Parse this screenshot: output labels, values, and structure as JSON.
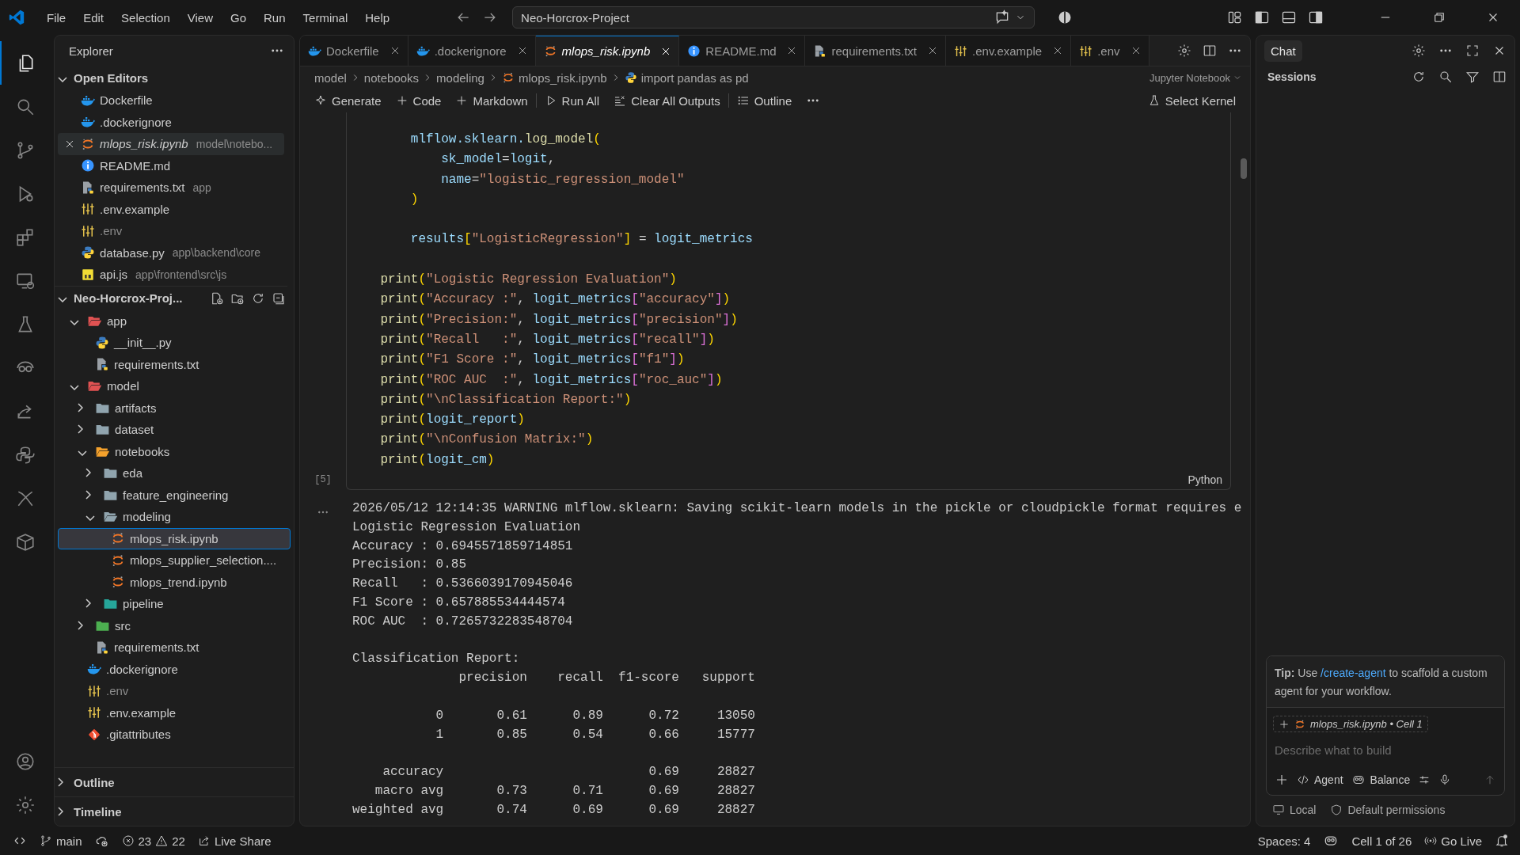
{
  "title_bar": {
    "menus": [
      "File",
      "Edit",
      "Selection",
      "View",
      "Go",
      "Run",
      "Terminal",
      "Help"
    ],
    "command_center": "Neo-Horcrox-Project"
  },
  "activity_bar": [
    {
      "selected": true
    },
    {
      "selected": false
    },
    {
      "selected": false
    },
    {
      "selected": false
    },
    {
      "selected": false
    },
    {
      "selected": false
    },
    {
      "selected": false
    },
    {
      "selected": false
    },
    {
      "selected": false
    },
    {
      "selected": false
    },
    {
      "selected": false
    },
    {
      "selected": false
    }
  ],
  "explorer": {
    "title": "Explorer",
    "open_editors": {
      "title": "Open Editors",
      "expanded": true,
      "items": [
        {
          "label": "Dockerfile",
          "kind": "docker",
          "selected": false,
          "preview": false,
          "dimmed": false
        },
        {
          "label": ".dockerignore",
          "kind": "docker",
          "selected": false,
          "preview": false,
          "dimmed": false
        },
        {
          "label": "mlops_risk.ipynb",
          "description": "model\\notebo...",
          "kind": "notebook",
          "selected": true,
          "preview": true,
          "dimmed": false
        },
        {
          "label": "README.md",
          "kind": "info",
          "selected": false,
          "preview": false,
          "dimmed": false
        },
        {
          "label": "requirements.txt",
          "description": "app",
          "kind": "text",
          "selected": false,
          "preview": false,
          "dimmed": false
        },
        {
          "label": ".env.example",
          "kind": "env",
          "selected": false,
          "preview": false,
          "dimmed": false
        },
        {
          "label": ".env",
          "kind": "env",
          "selected": false,
          "preview": false,
          "dimmed": true
        },
        {
          "label": "database.py",
          "description": "app\\backend\\core",
          "kind": "python",
          "selected": false,
          "preview": false,
          "dimmed": false
        },
        {
          "label": "api.js",
          "description": "app\\frontend\\src\\js",
          "kind": "js",
          "selected": false,
          "preview": false,
          "dimmed": false
        }
      ]
    },
    "folder": {
      "title": "Neo-Horcrox-Proj...",
      "expanded": true,
      "items": [
        {
          "label": "app",
          "kind": "folder",
          "color": "#e05252",
          "expanded": true,
          "selected": false,
          "dimmed": false,
          "children": [
            {
              "label": "__init__.py",
              "kind": "python",
              "selected": false,
              "dimmed": false
            },
            {
              "label": "requirements.txt",
              "kind": "text",
              "selected": false,
              "dimmed": false
            }
          ]
        },
        {
          "label": "model",
          "kind": "folder",
          "color": "#e05252",
          "expanded": true,
          "selected": false,
          "dimmed": false,
          "children": [
            {
              "label": "artifacts",
              "kind": "folder",
              "color": "#90a4ae",
              "expanded": false,
              "selected": false,
              "dimmed": false
            },
            {
              "label": "dataset",
              "kind": "folder",
              "color": "#90a4ae",
              "expanded": false,
              "selected": false,
              "dimmed": false
            },
            {
              "label": "notebooks",
              "kind": "folder",
              "color": "#f4a12c",
              "expanded": true,
              "selected": false,
              "dimmed": false,
              "children": [
                {
                  "label": "eda",
                  "kind": "folder",
                  "color": "#90a4ae",
                  "expanded": false,
                  "selected": false,
                  "dimmed": false
                },
                {
                  "label": "feature_engineering",
                  "kind": "folder",
                  "color": "#90a4ae",
                  "expanded": false,
                  "selected": false,
                  "dimmed": false
                },
                {
                  "label": "modeling",
                  "kind": "folder",
                  "color": "#90a4ae",
                  "expanded": true,
                  "selected": false,
                  "dimmed": false,
                  "children": [
                    {
                      "label": "mlops_risk.ipynb",
                      "kind": "notebook",
                      "selected": true,
                      "dimmed": false
                    },
                    {
                      "label": "mlops_supplier_selection....",
                      "kind": "notebook",
                      "selected": false,
                      "dimmed": false
                    },
                    {
                      "label": "mlops_trend.ipynb",
                      "kind": "notebook",
                      "selected": false,
                      "dimmed": false
                    }
                  ]
                },
                {
                  "label": "pipeline",
                  "kind": "folder",
                  "color": "#26a69a",
                  "expanded": false,
                  "selected": false,
                  "dimmed": false
                }
              ]
            },
            {
              "label": "src",
              "kind": "folder",
              "color": "#4caf50",
              "expanded": false,
              "selected": false,
              "dimmed": false
            },
            {
              "label": "requirements.txt",
              "kind": "text",
              "selected": false,
              "dimmed": false
            }
          ]
        },
        {
          "label": ".dockerignore",
          "kind": "docker",
          "selected": false,
          "dimmed": false
        },
        {
          "label": ".env",
          "kind": "env",
          "selected": false,
          "dimmed": true
        },
        {
          "label": ".env.example",
          "kind": "env",
          "selected": false,
          "dimmed": false
        },
        {
          "label": ".gitattributes",
          "kind": "git",
          "selected": false,
          "dimmed": false
        }
      ]
    },
    "sections": [
      {
        "title": "Outline",
        "expanded": false
      },
      {
        "title": "Timeline",
        "expanded": false
      }
    ]
  },
  "tabs": [
    {
      "label": "Dockerfile",
      "kind": "docker",
      "selected": false,
      "preview": false
    },
    {
      "label": ".dockerignore",
      "kind": "docker",
      "selected": false,
      "preview": false
    },
    {
      "label": "mlops_risk.ipynb",
      "kind": "notebook",
      "selected": true,
      "preview": true
    },
    {
      "label": "README.md",
      "kind": "info",
      "selected": false,
      "preview": false
    },
    {
      "label": "requirements.txt",
      "kind": "text",
      "selected": false,
      "preview": false
    },
    {
      "label": ".env.example",
      "kind": "env",
      "selected": false,
      "preview": false
    },
    {
      "label": ".env",
      "kind": "env",
      "selected": false,
      "preview": false
    }
  ],
  "breadcrumbs": [
    {
      "label": "model",
      "kind": "folder"
    },
    {
      "label": "notebooks",
      "kind": "folder"
    },
    {
      "label": "modeling",
      "kind": "folder"
    },
    {
      "label": "mlops_risk.ipynb",
      "kind": "notebook"
    },
    {
      "label": "import pandas as pd",
      "kind": "python"
    }
  ],
  "notebook_kind": "Jupyter Notebook",
  "toolbar": [
    {
      "kind": "generate",
      "label": "Generate"
    },
    {
      "kind": "code",
      "label": "Code"
    },
    {
      "kind": "markdown",
      "label": "Markdown"
    },
    {
      "kind": "divider"
    },
    {
      "kind": "run",
      "label": "Run All"
    },
    {
      "kind": "clear",
      "label": "Clear All Outputs"
    },
    {
      "kind": "divider"
    },
    {
      "kind": "outline",
      "label": "Outline"
    },
    {
      "kind": "more"
    }
  ],
  "kernel": "Select Kernel",
  "cell": {
    "execution_count": "[5]",
    "language": "Python",
    "lines": [
      {
        "kind": "code",
        "segments": [
          {
            "text": "        mlflow.sklearn.",
            "kind": "var"
          },
          {
            "text": "log_model",
            "kind": "fn"
          },
          {
            "text": "(",
            "kind": "b1"
          }
        ]
      },
      {
        "kind": "code",
        "segments": [
          {
            "text": "            sk_model",
            "kind": "var"
          },
          {
            "text": "=",
            "kind": "plain"
          },
          {
            "text": "logit",
            "kind": "var"
          },
          {
            "text": ",",
            "kind": "plain"
          }
        ]
      },
      {
        "kind": "code",
        "segments": [
          {
            "text": "            name",
            "kind": "var"
          },
          {
            "text": "=",
            "kind": "plain"
          },
          {
            "text": "\"logistic_regression_model\"",
            "kind": "str"
          }
        ]
      },
      {
        "kind": "code",
        "segments": [
          {
            "text": "        )",
            "kind": "b1"
          }
        ]
      },
      {
        "kind": "blank"
      },
      {
        "kind": "code",
        "segments": [
          {
            "text": "        results",
            "kind": "var"
          },
          {
            "text": "[",
            "kind": "b1"
          },
          {
            "text": "\"LogisticRegression\"",
            "kind": "str"
          },
          {
            "text": "]",
            "kind": "b1"
          },
          {
            "text": " = ",
            "kind": "plain"
          },
          {
            "text": "logit_metrics",
            "kind": "var"
          }
        ]
      },
      {
        "kind": "blank"
      },
      {
        "kind": "code",
        "segments": [
          {
            "text": "    print",
            "kind": "fn"
          },
          {
            "text": "(",
            "kind": "b1"
          },
          {
            "text": "\"Logistic Regression Evaluation\"",
            "kind": "str"
          },
          {
            "text": ")",
            "kind": "b1"
          }
        ]
      },
      {
        "kind": "code",
        "segments": [
          {
            "text": "    print",
            "kind": "fn"
          },
          {
            "text": "(",
            "kind": "b1"
          },
          {
            "text": "\"Accuracy :\"",
            "kind": "str"
          },
          {
            "text": ", ",
            "kind": "plain"
          },
          {
            "text": "logit_metrics",
            "kind": "var"
          },
          {
            "text": "[",
            "kind": "b2"
          },
          {
            "text": "\"accuracy\"",
            "kind": "str"
          },
          {
            "text": "]",
            "kind": "b2"
          },
          {
            "text": ")",
            "kind": "b1"
          }
        ]
      },
      {
        "kind": "code",
        "segments": [
          {
            "text": "    print",
            "kind": "fn"
          },
          {
            "text": "(",
            "kind": "b1"
          },
          {
            "text": "\"Precision:\"",
            "kind": "str"
          },
          {
            "text": ", ",
            "kind": "plain"
          },
          {
            "text": "logit_metrics",
            "kind": "var"
          },
          {
            "text": "[",
            "kind": "b2"
          },
          {
            "text": "\"precision\"",
            "kind": "str"
          },
          {
            "text": "]",
            "kind": "b2"
          },
          {
            "text": ")",
            "kind": "b1"
          }
        ]
      },
      {
        "kind": "code",
        "segments": [
          {
            "text": "    print",
            "kind": "fn"
          },
          {
            "text": "(",
            "kind": "b1"
          },
          {
            "text": "\"Recall   :\"",
            "kind": "str"
          },
          {
            "text": ", ",
            "kind": "plain"
          },
          {
            "text": "logit_metrics",
            "kind": "var"
          },
          {
            "text": "[",
            "kind": "b2"
          },
          {
            "text": "\"recall\"",
            "kind": "str"
          },
          {
            "text": "]",
            "kind": "b2"
          },
          {
            "text": ")",
            "kind": "b1"
          }
        ]
      },
      {
        "kind": "code",
        "segments": [
          {
            "text": "    print",
            "kind": "fn"
          },
          {
            "text": "(",
            "kind": "b1"
          },
          {
            "text": "\"F1 Score :\"",
            "kind": "str"
          },
          {
            "text": ", ",
            "kind": "plain"
          },
          {
            "text": "logit_metrics",
            "kind": "var"
          },
          {
            "text": "[",
            "kind": "b2"
          },
          {
            "text": "\"f1\"",
            "kind": "str"
          },
          {
            "text": "]",
            "kind": "b2"
          },
          {
            "text": ")",
            "kind": "b1"
          }
        ]
      },
      {
        "kind": "code",
        "segments": [
          {
            "text": "    print",
            "kind": "fn"
          },
          {
            "text": "(",
            "kind": "b1"
          },
          {
            "text": "\"ROC AUC  :\"",
            "kind": "str"
          },
          {
            "text": ", ",
            "kind": "plain"
          },
          {
            "text": "logit_metrics",
            "kind": "var"
          },
          {
            "text": "[",
            "kind": "b2"
          },
          {
            "text": "\"roc_auc\"",
            "kind": "str"
          },
          {
            "text": "]",
            "kind": "b2"
          },
          {
            "text": ")",
            "kind": "b1"
          }
        ]
      },
      {
        "kind": "code",
        "segments": [
          {
            "text": "    print",
            "kind": "fn"
          },
          {
            "text": "(",
            "kind": "b1"
          },
          {
            "text": "\"\\nClassification Report:\"",
            "kind": "str"
          },
          {
            "text": ")",
            "kind": "b1"
          }
        ]
      },
      {
        "kind": "code",
        "segments": [
          {
            "text": "    print",
            "kind": "fn"
          },
          {
            "text": "(",
            "kind": "b1"
          },
          {
            "text": "logit_report",
            "kind": "var"
          },
          {
            "text": ")",
            "kind": "b1"
          }
        ]
      },
      {
        "kind": "code",
        "segments": [
          {
            "text": "    print",
            "kind": "fn"
          },
          {
            "text": "(",
            "kind": "b1"
          },
          {
            "text": "\"\\nConfusion Matrix:\"",
            "kind": "str"
          },
          {
            "text": ")",
            "kind": "b1"
          }
        ]
      },
      {
        "kind": "code",
        "segments": [
          {
            "text": "    print",
            "kind": "fn"
          },
          {
            "text": "(",
            "kind": "b1"
          },
          {
            "text": "logit_cm",
            "kind": "var"
          },
          {
            "text": ")",
            "kind": "b1"
          }
        ]
      }
    ]
  },
  "output": {
    "text": "2026/05/12 12:14:35 WARNING mlflow.sklearn: Saving scikit-learn models in the pickle or cloudpickle format requires e\nLogistic Regression Evaluation\nAccuracy : 0.6945571859714851\nPrecision: 0.85\nRecall   : 0.5366039170945046\nF1 Score : 0.657885534444574\nROC AUC  : 0.7265732283548704\n\nClassification Report:\n              precision    recall  f1-score   support\n\n           0       0.61      0.89      0.72     13050\n           1       0.85      0.54      0.66     15777\n\n    accuracy                           0.69     28827\n   macro avg       0.73      0.71      0.69     28827\nweighted avg       0.74      0.69      0.69     28827"
  },
  "chat": {
    "tab": "Chat",
    "sessions_title": "Sessions",
    "tip": {
      "label": "Tip:",
      "before": "Use",
      "link": "/create-agent",
      "after": "to scaffold a custom agent for your workflow."
    },
    "context": "mlops_risk.ipynb • Cell 1",
    "placeholder": "Describe what to build",
    "mode": "Agent",
    "model": "Balance",
    "location": "Local",
    "permissions": "Default permissions"
  },
  "status_bar": {
    "left": [
      {
        "kind": "remote"
      },
      {
        "kind": "branch",
        "text": "main"
      },
      {
        "kind": "sync"
      },
      {
        "kind": "problems",
        "errors": "23",
        "warnings": "22"
      },
      {
        "kind": "liveshare",
        "text": "Live Share"
      }
    ],
    "right": [
      {
        "kind": "text",
        "text": "Spaces: 4"
      },
      {
        "kind": "copilot"
      },
      {
        "kind": "text",
        "text": "Cell 1 of 26"
      },
      {
        "kind": "golive",
        "text": "Go Live"
      },
      {
        "kind": "bell"
      }
    ]
  }
}
